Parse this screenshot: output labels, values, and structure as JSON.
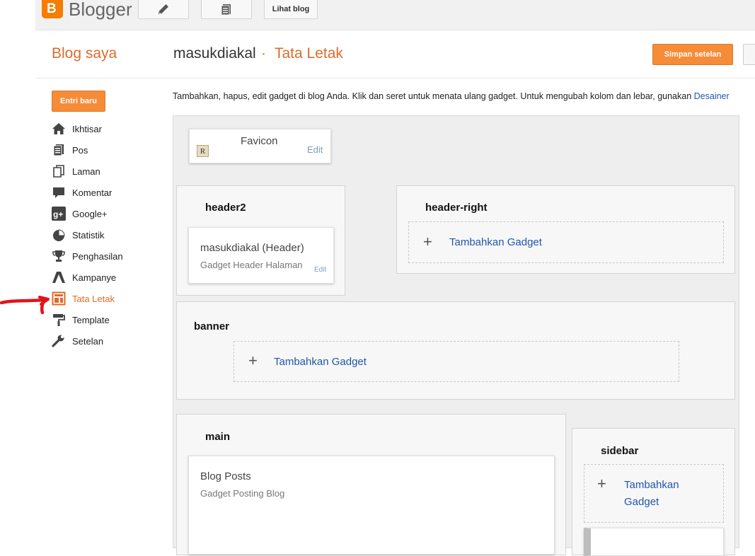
{
  "topbar": {
    "logo_letter": "B",
    "brand": "Blogger",
    "view_blog": "Lihat blog",
    "pencil_icon": "pencil-icon",
    "pages_icon": "pages-icon"
  },
  "header": {
    "my_blogs": "Blog saya",
    "blog_name": "masukdiakal",
    "separator": "·",
    "page_title": "Tata Letak",
    "save_button": "Simpan setelan"
  },
  "sidebar": {
    "new_post": "Entri baru",
    "items": [
      {
        "label": "Ikhtisar",
        "icon": "home-icon"
      },
      {
        "label": "Pos",
        "icon": "posts-icon"
      },
      {
        "label": "Laman",
        "icon": "pages-icon"
      },
      {
        "label": "Komentar",
        "icon": "comment-icon"
      },
      {
        "label": "Google+",
        "icon": "google-plus-icon"
      },
      {
        "label": "Statistik",
        "icon": "stats-icon"
      },
      {
        "label": "Penghasilan",
        "icon": "trophy-icon"
      },
      {
        "label": "Kampanye",
        "icon": "campaign-icon"
      },
      {
        "label": "Tata Letak",
        "icon": "layout-icon",
        "active": true
      },
      {
        "label": "Template",
        "icon": "template-icon"
      },
      {
        "label": "Setelan",
        "icon": "wrench-icon"
      }
    ]
  },
  "content": {
    "description": "Tambahkan, hapus, edit gadget di blog Anda. Klik dan seret untuk menata ulang gadget. Untuk mengubah kolom dan lebar, gunakan ",
    "description_link": "Desainer",
    "favicon": {
      "title": "Favicon",
      "edit": "Edit",
      "icon_letter": "R"
    },
    "header2": {
      "title": "header2",
      "widget_title": "masukdiakal (Header)",
      "widget_sub": "Gadget Header Halaman",
      "edit": "Edit"
    },
    "header_right": {
      "title": "header-right",
      "add_gadget": "Tambahkan Gadget"
    },
    "banner": {
      "title": "banner",
      "add_gadget": "Tambahkan Gadget"
    },
    "main": {
      "title": "main",
      "widget_title": "Blog Posts",
      "widget_sub": "Gadget Posting Blog"
    },
    "sidebar_section": {
      "title": "sidebar",
      "add_gadget_1": "Tambahkan",
      "add_gadget_2": "Gadget"
    }
  },
  "colors": {
    "accent": "#dd6b2a",
    "button": "#f68b38",
    "link": "#2156a8",
    "annotation": "#e0141c"
  }
}
